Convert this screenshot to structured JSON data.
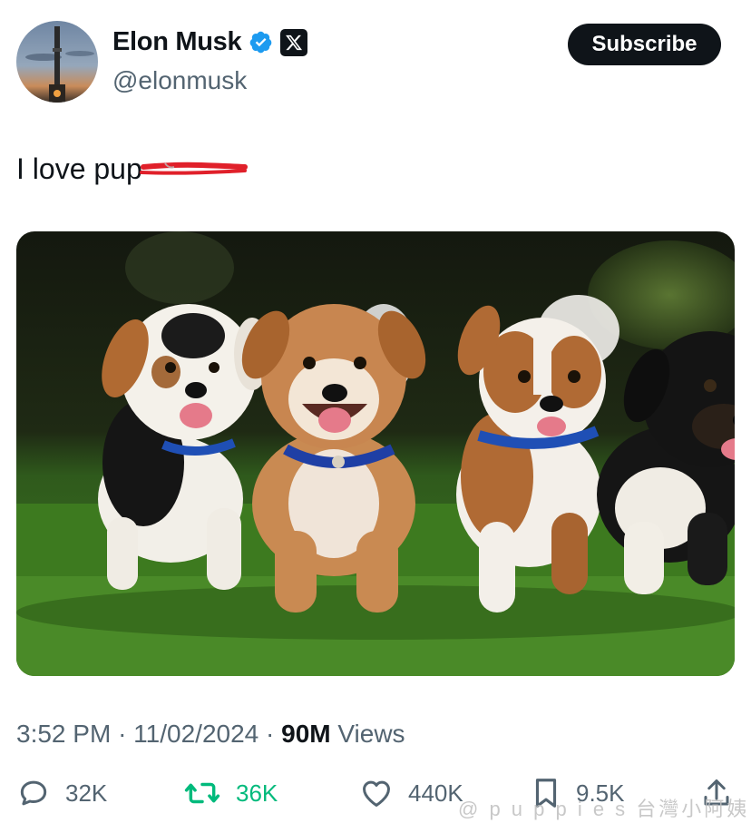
{
  "header": {
    "name": "Elon Musk",
    "handle": "@elonmusk",
    "subscribe_label": "Subscribe",
    "verified_icon": "verified-badge-icon",
    "affiliate_icon": "x-logo-icon"
  },
  "tweet": {
    "text": "I love pup",
    "media_icon": "puppies-photo"
  },
  "meta": {
    "time": "3:52 PM",
    "date": "11/02/2024",
    "views_count": "90M",
    "views_label": "Views",
    "separator": "·"
  },
  "actions": {
    "replies": "32K",
    "retweets": "36K",
    "likes": "440K",
    "bookmarks": "9.5K"
  },
  "watermark": "@ p u p p i e s 台灣小阿姨",
  "colors": {
    "text": "#0f1419",
    "muted": "#536471",
    "verified": "#1d9bf0",
    "retweet": "#00ba7c",
    "scribble": "#e0202a"
  }
}
